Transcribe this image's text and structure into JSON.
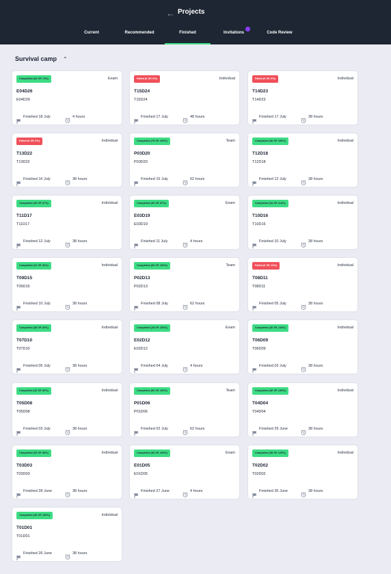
{
  "header": {
    "back_icon": "back-arrow-icon",
    "title": "Projects",
    "tabs": [
      {
        "label": "Current",
        "active": false
      },
      {
        "label": "Recommended",
        "active": false
      },
      {
        "label": "Finished",
        "active": true
      },
      {
        "label": "Invitations",
        "active": false,
        "badge": true
      },
      {
        "label": "Code Review",
        "active": false
      }
    ]
  },
  "section": {
    "title": "Survival camp",
    "icon": "chevron-up-icon"
  },
  "colors": {
    "header_bg": "#1e2633",
    "completed": "#3ddc84",
    "failed": "#f0505a",
    "badge": "#8b3dff",
    "page_bg": "#ebebf3"
  },
  "projects": [
    {
      "status": "Completed (34 XP, 74%)",
      "state": "completed",
      "type": "Exam",
      "name": "E04D26",
      "code": "E04D26",
      "finished": "Finished 18 July",
      "duration": "4 hours"
    },
    {
      "status": "Failed (0 XP, 0%)",
      "state": "failed",
      "type": "Individual",
      "name": "T15D24",
      "code": "T15D24",
      "finished": "Finished 17 July",
      "duration": "48 hours"
    },
    {
      "status": "Failed (0 XP, 0%)",
      "state": "failed",
      "type": "Individual",
      "name": "T14D23",
      "code": "T14D23",
      "finished": "Finished 17 July",
      "duration": "38 hours"
    },
    {
      "status": "Failed (0 XP, 0%)",
      "state": "failed",
      "type": "Individual",
      "name": "T13D22",
      "code": "T13D22",
      "finished": "Finished 16 July",
      "duration": "38 hours"
    },
    {
      "status": "Completed (75 XP, 100%)",
      "state": "completed",
      "type": "Team",
      "name": "P03D20",
      "code": "P03D20",
      "finished": "Finished 15 July",
      "duration": "62 hours"
    },
    {
      "status": "Completed (46 XP, 100%)",
      "state": "completed",
      "type": "Individual",
      "name": "T12D18",
      "code": "T12D18",
      "finished": "Finished 12 July",
      "duration": "38 hours"
    },
    {
      "status": "Completed (30 XP, 67%)",
      "state": "completed",
      "type": "Individual",
      "name": "T11D17",
      "code": "T11D17",
      "finished": "Finished 12 July",
      "duration": "38 hours"
    },
    {
      "status": "Completed (40 XP, 87%)",
      "state": "completed",
      "type": "Exam",
      "name": "E03D19",
      "code": "E03D19",
      "finished": "Finished 11 July",
      "duration": "4 hours"
    },
    {
      "status": "Completed (34 XP, 114%)",
      "state": "completed",
      "type": "Individual",
      "name": "T10D16",
      "code": "T10D16",
      "finished": "Finished 10 July",
      "duration": "38 hours"
    },
    {
      "status": "Completed (22 XP, 52%)",
      "state": "completed",
      "type": "Individual",
      "name": "T09D15",
      "code": "T09D15",
      "finished": "Finished 10 July",
      "duration": "38 hours"
    },
    {
      "status": "Completed (60 XP, 100%)",
      "state": "completed",
      "type": "Team",
      "name": "P02D13",
      "code": "P02D13",
      "finished": "Finished 08 July",
      "duration": "62 hours"
    },
    {
      "status": "Failed (6 XP, 12%)",
      "state": "failed",
      "type": "Individual",
      "name": "T08D11",
      "code": "T08D11",
      "finished": "Finished 05 July",
      "duration": "38 hours"
    },
    {
      "status": "Completed (38 XP, 84%)",
      "state": "completed",
      "type": "Individual",
      "name": "T07D10",
      "code": "T07D10",
      "finished": "Finished 05 July",
      "duration": "38 hours"
    },
    {
      "status": "Completed (45 XP, 100%)",
      "state": "completed",
      "type": "Exam",
      "name": "E02D12",
      "code": "E02D12",
      "finished": "Finished 04 July",
      "duration": "4 hours"
    },
    {
      "status": "Completed (40 XP, 134%)",
      "state": "completed",
      "type": "Individual",
      "name": "T06D09",
      "code": "T06D09",
      "finished": "Finished 03 July",
      "duration": "38 hours"
    },
    {
      "status": "Completed (43 XP, 96%)",
      "state": "completed",
      "type": "Individual",
      "name": "T05D08",
      "code": "T05D08",
      "finished": "Finished 03 July",
      "duration": "38 hours"
    },
    {
      "status": "Completed (60 XP, 100%)",
      "state": "completed",
      "type": "Team",
      "name": "P01D06",
      "code": "P01D06",
      "finished": "Finished 02 July",
      "duration": "62 hours"
    },
    {
      "status": "Completed (40 XP, 133%)",
      "state": "completed",
      "type": "Individual",
      "name": "T04D04",
      "code": "T04D04",
      "finished": "Finished 29 June",
      "duration": "38 hours"
    },
    {
      "status": "Completed (29 XP, 98%)",
      "state": "completed",
      "type": "Individual",
      "name": "T03D03",
      "code": "T03D03",
      "finished": "Finished 28 June",
      "duration": "38 hours"
    },
    {
      "status": "Completed (45 XP, 100%)",
      "state": "completed",
      "type": "Exam",
      "name": "E01D05",
      "code": "E01D05",
      "finished": "Finished 27 June",
      "duration": "4 hours"
    },
    {
      "status": "Completed (38 XP, 125%)",
      "state": "completed",
      "type": "Individual",
      "name": "T02D02",
      "code": "T02D02",
      "finished": "Finished 26 June",
      "duration": "38 hours"
    },
    {
      "status": "Completed (30 XP, 100%)",
      "state": "completed",
      "type": "Individual",
      "name": "T01D01",
      "code": "T01D01",
      "finished": "Finished 26 June",
      "duration": "38 hours"
    }
  ]
}
